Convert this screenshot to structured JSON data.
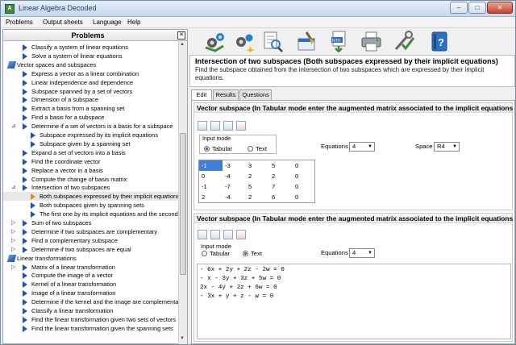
{
  "window": {
    "title": "Linear Algebra Decoded",
    "minimize": "–",
    "maximize": "□",
    "close": "✕"
  },
  "menu": [
    "Problems",
    "Output sheets",
    "Language",
    "Help"
  ],
  "left_panel": {
    "title": "Problems",
    "close": "✕"
  },
  "tree": [
    {
      "label": "Classify a system of linear equations",
      "level": 3,
      "kind": "item"
    },
    {
      "label": "Solve a system of linear equations",
      "level": 3,
      "kind": "item"
    },
    {
      "label": "Vector spaces and subspaces",
      "level": 1,
      "kind": "folder",
      "toggle": "⊿"
    },
    {
      "label": "Express a vector as a linear combination",
      "level": 3,
      "kind": "item"
    },
    {
      "label": "Linear independence and dependence",
      "level": 3,
      "kind": "item"
    },
    {
      "label": "Subspace spanned by a set of vectors",
      "level": 3,
      "kind": "item"
    },
    {
      "label": "Dimension of a subspace",
      "level": 3,
      "kind": "item"
    },
    {
      "label": "Extract a basis from a spanning set",
      "level": 3,
      "kind": "item"
    },
    {
      "label": "Find a basis for a subspace",
      "level": 3,
      "kind": "item"
    },
    {
      "label": "Determine if a set of vectors is a basis for a subspace",
      "level": 3,
      "kind": "item",
      "toggle": "⊿"
    },
    {
      "label": "Subspace expressed by its implicit equations",
      "level": 4,
      "kind": "item"
    },
    {
      "label": "Subspace given by a spanning set",
      "level": 4,
      "kind": "item"
    },
    {
      "label": "Expand a set of vectors into a basis",
      "level": 3,
      "kind": "item"
    },
    {
      "label": "Find the coordinate vector",
      "level": 3,
      "kind": "item"
    },
    {
      "label": "Replace a vector in a basis",
      "level": 3,
      "kind": "item"
    },
    {
      "label": "Compute the change of basis matrix",
      "level": 3,
      "kind": "item"
    },
    {
      "label": "Intersection of two subspaces",
      "level": 3,
      "kind": "item",
      "toggle": "⊿"
    },
    {
      "label": "Both subspaces expressed by their implicit equations",
      "level": 4,
      "kind": "item",
      "selected": true
    },
    {
      "label": "Both subspaces given by spanning sets",
      "level": 4,
      "kind": "item"
    },
    {
      "label": "The first one by its implicit equations and the second",
      "level": 4,
      "kind": "item"
    },
    {
      "label": "Sum of two subspaces",
      "level": 3,
      "kind": "item",
      "toggle": "▷"
    },
    {
      "label": "Determine if two subspaces are complementary",
      "level": 3,
      "kind": "item",
      "toggle": "▷"
    },
    {
      "label": "Find a complementary subspace",
      "level": 3,
      "kind": "item",
      "toggle": "▷"
    },
    {
      "label": "Determine if two subspaces are equal",
      "level": 3,
      "kind": "item",
      "toggle": "▷"
    },
    {
      "label": "Linear transformations",
      "level": 1,
      "kind": "folder",
      "toggle": "⊿"
    },
    {
      "label": "Matrix of a linear transformation",
      "level": 3,
      "kind": "item",
      "toggle": "▷"
    },
    {
      "label": "Compute the image of a vector",
      "level": 3,
      "kind": "item"
    },
    {
      "label": "Kernel of a linear transformation",
      "level": 3,
      "kind": "item"
    },
    {
      "label": "Image of a linear transformation",
      "level": 3,
      "kind": "item"
    },
    {
      "label": "Determine if the kernel and the image are complementary",
      "level": 3,
      "kind": "item"
    },
    {
      "label": "Classify a linear transformation",
      "level": 3,
      "kind": "item"
    },
    {
      "label": "Find the linear transformation given two sets of vectors",
      "level": 3,
      "kind": "item"
    },
    {
      "label": "Find the linear transformation given the spanning sets",
      "level": 3,
      "kind": "item"
    }
  ],
  "toolbar": [
    "gears-icon",
    "gears-sparkle-icon",
    "document-search-icon",
    "clear-icon",
    "rtf-export-icon",
    "printer-icon",
    "settings-check-icon",
    "help-book-icon"
  ],
  "description": {
    "title": "Intersection of two subspaces (Both subspaces expressed by their implicit equations)",
    "text": "Find the subspace obtained from the intersection of two subspaces which are expressed by their implicit equations."
  },
  "tabs": [
    "Edit",
    "Results",
    "Questions"
  ],
  "section1": {
    "title": "Vector subspace (In Tabular mode enter the augmented matrix associated to the implicit equations)",
    "input_mode": "Input mode",
    "tabular": "Tabular",
    "text": "Text",
    "equations_label": "Equations",
    "equations_value": "4",
    "space_label": "Space",
    "space_value": "R4",
    "matrix": [
      [
        "-1",
        "-3",
        "3",
        "5",
        "0"
      ],
      [
        "0",
        "-4",
        "2",
        "2",
        "0"
      ],
      [
        "-1",
        "-7",
        "5",
        "7",
        "0"
      ],
      [
        "2",
        "-4",
        "2",
        "6",
        "0"
      ]
    ]
  },
  "section2": {
    "title": "Vector subspace (In Tabular mode enter the augmented matrix associated to the implicit equations)",
    "input_mode": "Input mode",
    "tabular": "Tabular",
    "text": "Text",
    "equations_label": "Equations",
    "equations_value": "4",
    "lines": [
      "- 6x + 2y + 2z - 2w = 0",
      "- x - 3y + 3z + 5w = 0",
      "2x - 4y + 2z + 6w = 0",
      "- 3x + y + z - w = 0"
    ]
  },
  "colors": {
    "accent": "#1c54b4",
    "selection": "#3f7fd8",
    "titlebar": "#c5d7ee",
    "close_button": "#c4432a"
  }
}
